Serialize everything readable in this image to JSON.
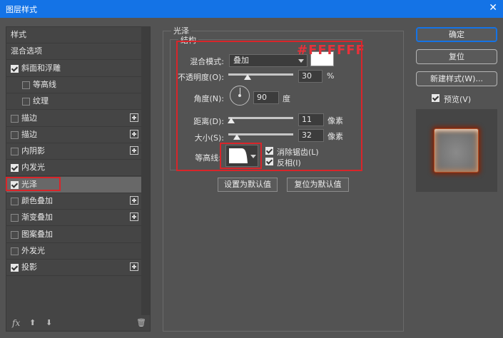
{
  "window": {
    "title": "图层样式",
    "close_glyph": "✕"
  },
  "sidebar": {
    "items": [
      {
        "label": "样式",
        "checkbox": false,
        "checked": false,
        "plus": false,
        "indent": false,
        "selected": false
      },
      {
        "label": "混合选项",
        "checkbox": false,
        "checked": false,
        "plus": false,
        "indent": false,
        "selected": false
      },
      {
        "label": "斜面和浮雕",
        "checkbox": true,
        "checked": true,
        "plus": false,
        "indent": false,
        "selected": false
      },
      {
        "label": "等高线",
        "checkbox": true,
        "checked": false,
        "plus": false,
        "indent": true,
        "selected": false
      },
      {
        "label": "纹理",
        "checkbox": true,
        "checked": false,
        "plus": false,
        "indent": true,
        "selected": false
      },
      {
        "label": "描边",
        "checkbox": true,
        "checked": false,
        "plus": true,
        "indent": false,
        "selected": false
      },
      {
        "label": "描边",
        "checkbox": true,
        "checked": false,
        "plus": true,
        "indent": false,
        "selected": false
      },
      {
        "label": "内阴影",
        "checkbox": true,
        "checked": false,
        "plus": true,
        "indent": false,
        "selected": false
      },
      {
        "label": "内发光",
        "checkbox": true,
        "checked": true,
        "plus": false,
        "indent": false,
        "selected": false
      },
      {
        "label": "光泽",
        "checkbox": true,
        "checked": true,
        "plus": false,
        "indent": false,
        "selected": true
      },
      {
        "label": "颜色叠加",
        "checkbox": true,
        "checked": false,
        "plus": true,
        "indent": false,
        "selected": false
      },
      {
        "label": "渐变叠加",
        "checkbox": true,
        "checked": false,
        "plus": true,
        "indent": false,
        "selected": false
      },
      {
        "label": "图案叠加",
        "checkbox": true,
        "checked": false,
        "plus": false,
        "indent": false,
        "selected": false
      },
      {
        "label": "外发光",
        "checkbox": true,
        "checked": false,
        "plus": false,
        "indent": false,
        "selected": false
      },
      {
        "label": "投影",
        "checkbox": true,
        "checked": true,
        "plus": true,
        "indent": false,
        "selected": false
      }
    ],
    "footer": {
      "fx": "fx",
      "up": "⬆",
      "down": "⬇",
      "trash": "🗑"
    }
  },
  "satin": {
    "group_title": "光泽",
    "structure_title": "结构",
    "blend_mode_label": "混合模式:",
    "blend_mode_value": "叠加",
    "color_annotation": "#FFFFFF",
    "color": "#ffffff",
    "opacity_label": "不透明度(O):",
    "opacity_value": "30",
    "opacity_unit": "%",
    "opacity_fraction": 0.3,
    "angle_label": "角度(N):",
    "angle_value": "90",
    "angle_unit": "度",
    "distance_label": "距离(D):",
    "distance_value": "11",
    "distance_unit": "像素",
    "distance_fraction": 0.044,
    "size_label": "大小(S):",
    "size_value": "32",
    "size_unit": "像素",
    "size_fraction": 0.128,
    "contour_label": "等高线:",
    "antialias_label": "消除锯齿(L)",
    "antialias_checked": true,
    "invert_label": "反相(I)",
    "invert_checked": true,
    "make_default": "设置为默认值",
    "reset_default": "复位为默认值"
  },
  "actions": {
    "ok": "确定",
    "reset": "复位",
    "new_style": "新建样式(W)...",
    "preview_label": "预览(V)",
    "preview_checked": true
  },
  "colors": {
    "accent": "#1473e6",
    "annotation_red": "#d9252a"
  }
}
